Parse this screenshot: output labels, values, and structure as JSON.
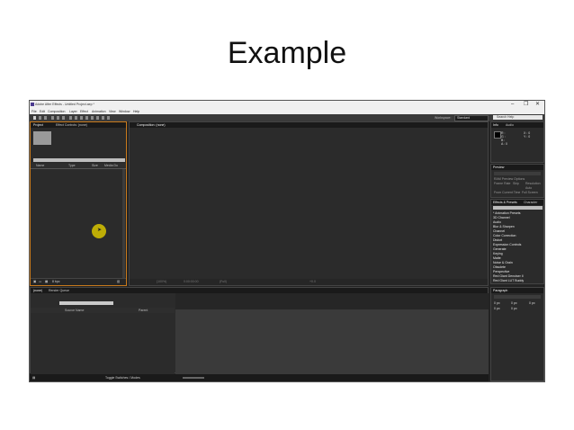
{
  "slide": {
    "title": "Example"
  },
  "app": {
    "window_title": "Adobe After Effects - Untitled Project.aep *",
    "window_controls": {
      "minimize": "–",
      "maximize": "❐",
      "close": "✕"
    },
    "menu": [
      "File",
      "Edit",
      "Composition",
      "Layer",
      "Effect",
      "Animation",
      "View",
      "Window",
      "Help"
    ],
    "toolbar": {
      "workspace_label": "Workspace:",
      "workspace_value": "Standard",
      "search_help_placeholder": "Search Help"
    },
    "project_panel": {
      "tabs": [
        "Project",
        "Effect Controls: (none)"
      ],
      "columns": [
        "Name",
        "Type",
        "Size",
        "Media Du"
      ],
      "footer": {
        "bpc": "8 bpc"
      }
    },
    "composition_panel": {
      "tabs": [
        "Composition: (none)"
      ],
      "footer": {
        "zoom": "(100%)",
        "resolution": "(Full)",
        "timecode": "0:00:00:00",
        "exposure": "+0.0"
      }
    },
    "info_panel": {
      "tabs": [
        "Info",
        "Audio"
      ],
      "values": [
        "R :",
        "G :",
        "B :",
        "A : 0",
        "X : 0",
        "Y : 0"
      ]
    },
    "preview_panel": {
      "tabs": [
        "Preview"
      ],
      "labels": [
        "RAM Preview Options",
        "Frame Rate",
        "Skip",
        "Resolution",
        "Auto",
        "From Current Time",
        "Full Screen"
      ]
    },
    "effects_panel": {
      "tabs": [
        "Effects & Presets",
        "Character"
      ],
      "items": [
        "* Animation Presets",
        "3D Channel",
        "Audio",
        "Blur & Sharpen",
        "Channel",
        "Color Correction",
        "Distort",
        "Expression Controls",
        "Generate",
        "Keying",
        "Matte",
        "Noise & Grain",
        "Obsolete",
        "Perspective",
        "Red Giant Denoiser II",
        "Red Giant LUT Buddy"
      ]
    },
    "paragraph_panel": {
      "tabs": [
        "Paragraph"
      ],
      "values": [
        "0 px",
        "0 px",
        "0 px",
        "0 px",
        "0 px"
      ]
    },
    "timeline_panel": {
      "tabs": [
        "(none)",
        "Render Queue"
      ],
      "columns": [
        "Source Name",
        "Parent"
      ]
    },
    "statusbar": {
      "toggle_label": "Toggle Switches / Modes"
    }
  }
}
